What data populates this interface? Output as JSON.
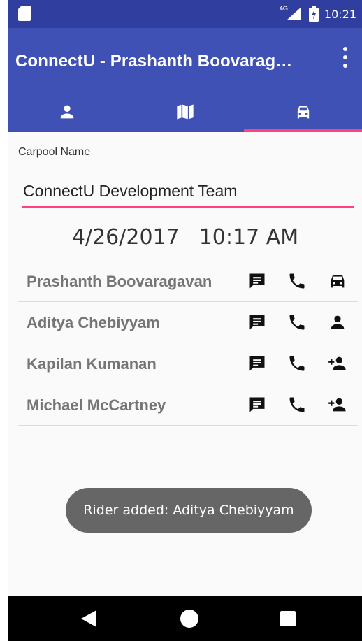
{
  "status_bar": {
    "network_label": "4G",
    "time": "10:21",
    "icons": [
      "sd-card-icon",
      "signal-icon",
      "battery-charging-icon"
    ]
  },
  "toolbar": {
    "title": "ConnectU - Prashanth Boovarag…",
    "overflow_icon": "overflow-menu-icon"
  },
  "tabs": [
    {
      "icon": "person-icon",
      "active": false
    },
    {
      "icon": "map-icon",
      "active": false
    },
    {
      "icon": "car-icon",
      "active": true
    }
  ],
  "accent_color": "#ff4081",
  "primary_color": "#3f51b5",
  "carpool": {
    "name_label": "Carpool Name",
    "name_value": "ConnectU Development Team",
    "date": "4/26/2017",
    "time": "10:17 AM"
  },
  "members": [
    {
      "name": "Prashanth Boovaragavan",
      "role_icon": "car-icon"
    },
    {
      "name": "Aditya Chebiyyam",
      "role_icon": "person-icon"
    },
    {
      "name": "Kapilan Kumanan",
      "role_icon": "add-person-icon"
    },
    {
      "name": "Michael McCartney",
      "role_icon": "add-person-icon"
    }
  ],
  "toast": {
    "message": "Rider added: Aditya Chebiyyam"
  }
}
